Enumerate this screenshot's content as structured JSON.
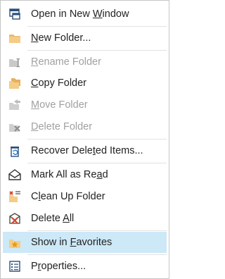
{
  "menu": {
    "items": [
      {
        "pre": "Open in New ",
        "acc": "W",
        "post": "indow",
        "icon": "open-window-icon",
        "disabled": false
      },
      {
        "pre": "",
        "acc": "N",
        "post": "ew Folder...",
        "icon": "folder-icon",
        "disabled": false
      },
      {
        "pre": "",
        "acc": "R",
        "post": "ename Folder",
        "icon": "rename-folder-icon",
        "disabled": true
      },
      {
        "pre": "",
        "acc": "C",
        "post": "opy Folder",
        "icon": "copy-folder-icon",
        "disabled": false
      },
      {
        "pre": "",
        "acc": "M",
        "post": "ove Folder",
        "icon": "move-folder-icon",
        "disabled": true
      },
      {
        "pre": "",
        "acc": "D",
        "post": "elete Folder",
        "icon": "delete-folder-icon",
        "disabled": true
      },
      {
        "pre": "Recover Dele",
        "acc": "t",
        "post": "ed Items...",
        "icon": "recover-items-icon",
        "disabled": false
      },
      {
        "pre": "Mark All as Re",
        "acc": "a",
        "post": "d",
        "icon": "envelope-open-icon",
        "disabled": false
      },
      {
        "pre": "C",
        "acc": "l",
        "post": "ean Up Folder",
        "icon": "clean-up-icon",
        "disabled": false
      },
      {
        "pre": "Delete ",
        "acc": "A",
        "post": "ll",
        "icon": "delete-all-icon",
        "disabled": false
      },
      {
        "pre": "Show in ",
        "acc": "F",
        "post": "avorites",
        "icon": "favorites-star-icon",
        "disabled": false
      },
      {
        "pre": "P",
        "acc": "r",
        "post": "operties...",
        "icon": "properties-icon",
        "disabled": false
      }
    ]
  }
}
